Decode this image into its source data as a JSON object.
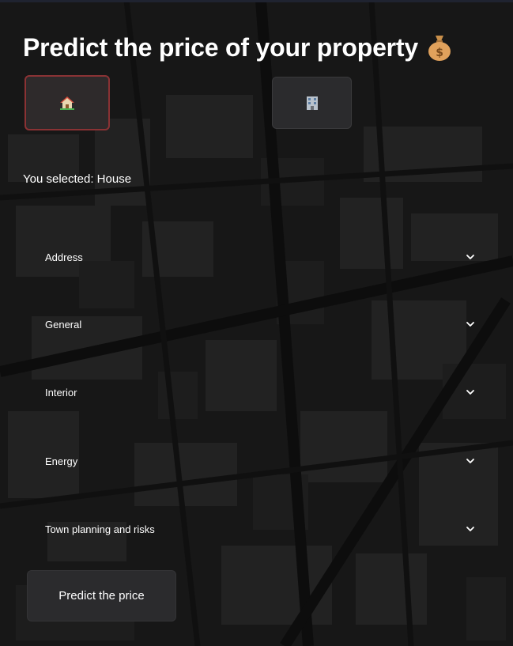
{
  "header": {
    "title": "Predict the price of your property",
    "title_icon": "money-bag-icon"
  },
  "property_types": [
    {
      "id": "house",
      "icon": "house-icon",
      "selected": true
    },
    {
      "id": "apartment",
      "icon": "office-building-icon",
      "selected": false
    }
  ],
  "selection_text": "You selected: House",
  "sections": [
    {
      "label": "Address",
      "icon": "chevron-down-icon"
    },
    {
      "label": "General",
      "icon": "chevron-down-icon"
    },
    {
      "label": "Interior",
      "icon": "chevron-down-icon"
    },
    {
      "label": "Energy",
      "icon": "chevron-down-icon"
    },
    {
      "label": "Town planning and risks",
      "icon": "chevron-down-icon"
    }
  ],
  "actions": {
    "predict_label": "Predict the price"
  },
  "colors": {
    "background": "#161616",
    "button_bg": "#2b2b2d",
    "selected_border": "#8a3234",
    "text": "#ffffff"
  }
}
